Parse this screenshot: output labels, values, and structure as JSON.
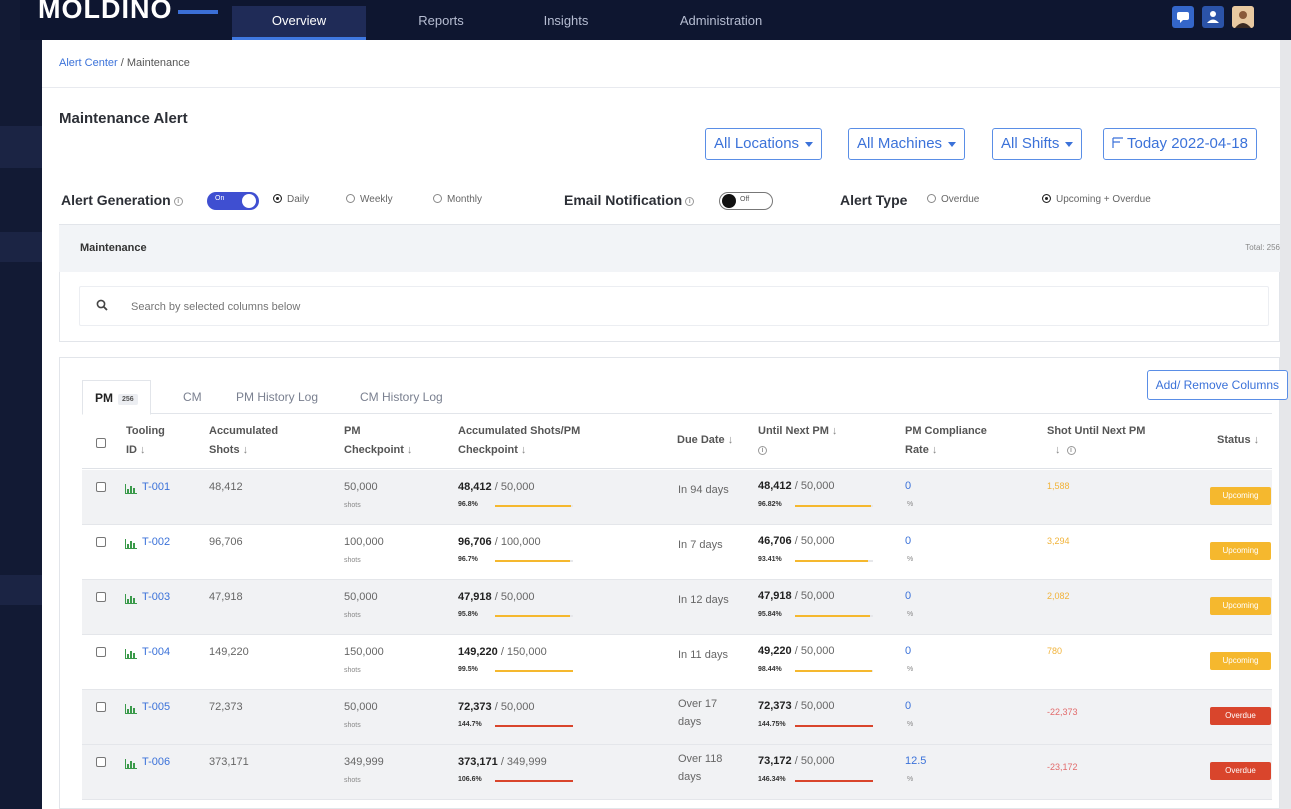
{
  "nav": {
    "logo": "MOLDINO",
    "tabs": [
      "Overview",
      "Reports",
      "Insights",
      "Administration"
    ],
    "active_tab": "Overview"
  },
  "breadcrumb": {
    "parent": "Alert Center",
    "separator": " / ",
    "current": "Maintenance"
  },
  "page_title": "Maintenance Alert",
  "filters": {
    "locations": "All Locations",
    "machines": "All Machines",
    "shifts": "All Shifts",
    "date": "Today 2022-04-18"
  },
  "settings": {
    "alert_generation_label": "Alert Generation",
    "alert_generation_toggle": "On",
    "frequency_options": [
      "Daily",
      "Weekly",
      "Monthly"
    ],
    "frequency_selected": "Daily",
    "email_label": "Email Notification",
    "email_toggle": "Off",
    "alert_type_label": "Alert Type",
    "alert_type_options": [
      "Overdue",
      "Upcoming + Overdue"
    ],
    "alert_type_selected": "Upcoming + Overdue"
  },
  "section": {
    "title": "Maintenance",
    "total": "Total: 256"
  },
  "search": {
    "placeholder": "Search by selected columns below"
  },
  "tabs": [
    {
      "label": "PM",
      "badge": "256"
    },
    {
      "label": "CM"
    },
    {
      "label": "PM History Log"
    },
    {
      "label": "CM History Log"
    }
  ],
  "add_remove_columns": "Add/ Remove Columns",
  "columns": {
    "tooling_id": [
      "Tooling",
      "ID"
    ],
    "accumulated_shots": [
      "Accumulated",
      "Shots"
    ],
    "pm_checkpoint": [
      "PM",
      "Checkpoint"
    ],
    "acc_per_pm": [
      "Accumulated Shots/PM",
      "Checkpoint"
    ],
    "due_date": "Due Date",
    "until_next_pm": "Until Next PM",
    "pm_compliance": [
      "PM Compliance",
      "Rate"
    ],
    "shot_until_next": "Shot Until Next PM",
    "status": "Status"
  },
  "sort_arrow": "↓",
  "info_glyph": "i",
  "units": {
    "shots": "shots",
    "percent": "%"
  },
  "rows": [
    {
      "id": "T-001",
      "acc": "48,412",
      "checkpoint": "50,000",
      "acc_bold": "48,412",
      "acc_total": " / 50,000",
      "acc_pct": "96.8%",
      "acc_progress": 0.968,
      "due": [
        "In 94 days"
      ],
      "next_bold": "48,412",
      "next_total": " / 50,000",
      "next_pct": "96.82%",
      "next_progress": 0.968,
      "compliance": "0",
      "shot_until": "1,588",
      "status": "Upcoming"
    },
    {
      "id": "T-002",
      "acc": "96,706",
      "checkpoint": "100,000",
      "acc_bold": "96,706",
      "acc_total": " / 100,000",
      "acc_pct": "96.7%",
      "acc_progress": 0.967,
      "due": [
        "In 7 days"
      ],
      "next_bold": "46,706",
      "next_total": " / 50,000",
      "next_pct": "93.41%",
      "next_progress": 0.934,
      "compliance": "0",
      "shot_until": "3,294",
      "status": "Upcoming"
    },
    {
      "id": "T-003",
      "acc": "47,918",
      "checkpoint": "50,000",
      "acc_bold": "47,918",
      "acc_total": " / 50,000",
      "acc_pct": "95.8%",
      "acc_progress": 0.958,
      "due": [
        "In 12 days"
      ],
      "next_bold": "47,918",
      "next_total": " / 50,000",
      "next_pct": "95.84%",
      "next_progress": 0.958,
      "compliance": "0",
      "shot_until": "2,082",
      "status": "Upcoming"
    },
    {
      "id": "T-004",
      "acc": "149,220",
      "checkpoint": "150,000",
      "acc_bold": "149,220",
      "acc_total": " / 150,000",
      "acc_pct": "99.5%",
      "acc_progress": 0.995,
      "due": [
        "In 11 days"
      ],
      "next_bold": "49,220",
      "next_total": " / 50,000",
      "next_pct": "98.44%",
      "next_progress": 0.984,
      "compliance": "0",
      "shot_until": "780",
      "status": "Upcoming"
    },
    {
      "id": "T-005",
      "acc": "72,373",
      "checkpoint": "50,000",
      "acc_bold": "72,373",
      "acc_total": " / 50,000",
      "acc_pct": "144.7%",
      "acc_progress": 1.0,
      "due": [
        "Over 17",
        "days"
      ],
      "next_bold": "72,373",
      "next_total": " / 50,000",
      "next_pct": "144.75%",
      "next_progress": 1.0,
      "compliance": "0",
      "shot_until": "-22,373",
      "status": "Overdue"
    },
    {
      "id": "T-006",
      "acc": "373,171",
      "checkpoint": "349,999",
      "acc_bold": "373,171",
      "acc_total": " / 349,999",
      "acc_pct": "106.6%",
      "acc_progress": 1.0,
      "due": [
        "Over 118",
        "days"
      ],
      "next_bold": "73,172",
      "next_total": " / 50,000",
      "next_pct": "146.34%",
      "next_progress": 1.0,
      "compliance": "12.5",
      "shot_until": "-23,172",
      "status": "Overdue"
    }
  ],
  "colors": {
    "navbar": "#0e1630",
    "accent": "#3b72d9",
    "toggle_on": "#3f4fd1",
    "upcoming": "#f5b82e",
    "overdue": "#d9452c",
    "shot_positive": "#f1b33a",
    "shot_negative": "#e26b6b"
  },
  "icons": {
    "nav": [
      "chat-icon",
      "user-icon",
      "avatar"
    ],
    "search": "search-icon",
    "row_chart": "bar-chart-icon",
    "checkbox": "checkbox-icon"
  }
}
